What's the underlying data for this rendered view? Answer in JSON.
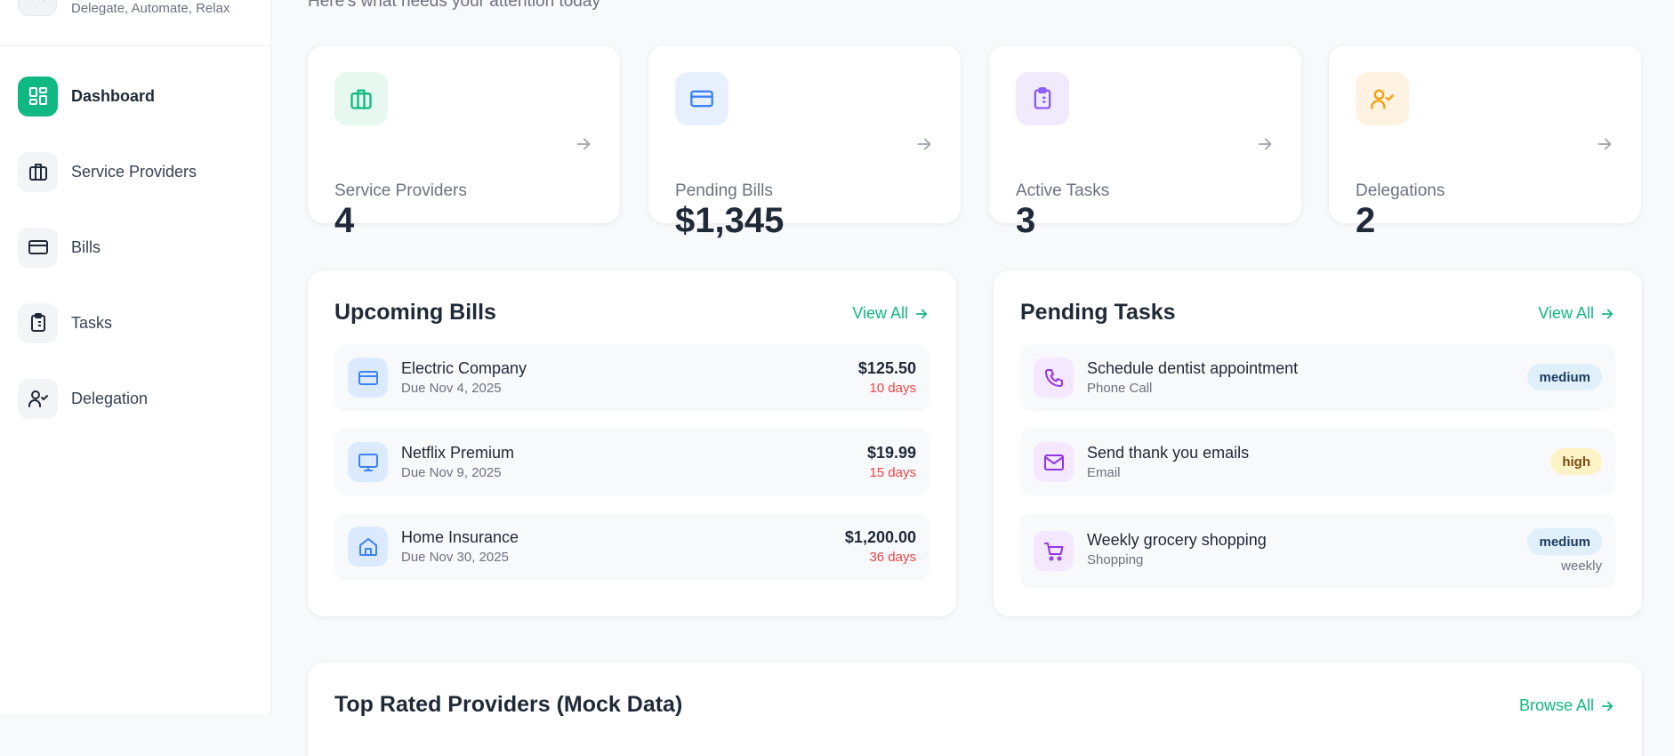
{
  "sidebar": {
    "tagline": "Delegate, Automate, Relax",
    "items": [
      {
        "label": "Dashboard",
        "icon": "grid-icon",
        "active": true
      },
      {
        "label": "Service Providers",
        "icon": "briefcase-icon"
      },
      {
        "label": "Bills",
        "icon": "credit-card-icon"
      },
      {
        "label": "Tasks",
        "icon": "clipboard-icon"
      },
      {
        "label": "Delegation",
        "icon": "user-check-icon"
      }
    ]
  },
  "header": {
    "subtitle": "Here's what needs your attention today"
  },
  "stats": [
    {
      "label": "Service Providers",
      "value": "4",
      "icon": "briefcase-icon",
      "color": "#10b981",
      "bg": "#e7f8f1"
    },
    {
      "label": "Pending Bills",
      "value": "$1,345",
      "icon": "credit-card-icon",
      "color": "#3b82f6",
      "bg": "#e8f0fe"
    },
    {
      "label": "Active Tasks",
      "value": "3",
      "icon": "clipboard-icon",
      "color": "#8b5cf6",
      "bg": "#f1eafd"
    },
    {
      "label": "Delegations",
      "value": "2",
      "icon": "user-check-icon",
      "color": "#f59e0b",
      "bg": "#fef3e2"
    }
  ],
  "upcoming_bills": {
    "title": "Upcoming Bills",
    "view_all": "View All",
    "items": [
      {
        "name": "Electric Company",
        "due": "Due Nov 4, 2025",
        "amount": "$125.50",
        "days": "10 days",
        "icon": "credit-card-icon"
      },
      {
        "name": "Netflix Premium",
        "due": "Due Nov 9, 2025",
        "amount": "$19.99",
        "days": "15 days",
        "icon": "monitor-icon"
      },
      {
        "name": "Home Insurance",
        "due": "Due Nov 30, 2025",
        "amount": "$1,200.00",
        "days": "36 days",
        "icon": "home-icon"
      }
    ]
  },
  "pending_tasks": {
    "title": "Pending Tasks",
    "view_all": "View All",
    "items": [
      {
        "name": "Schedule dentist appointment",
        "type": "Phone Call",
        "priority": "medium",
        "icon": "phone-icon"
      },
      {
        "name": "Send thank you emails",
        "type": "Email",
        "priority": "high",
        "icon": "mail-icon"
      },
      {
        "name": "Weekly grocery shopping",
        "type": "Shopping",
        "priority": "medium",
        "recurrence": "weekly",
        "icon": "cart-icon"
      }
    ]
  },
  "top_providers": {
    "title": "Top Rated Providers (Mock Data)",
    "browse_all": "Browse All"
  },
  "colors": {
    "accent": "#10b981",
    "danger": "#ef4444"
  }
}
